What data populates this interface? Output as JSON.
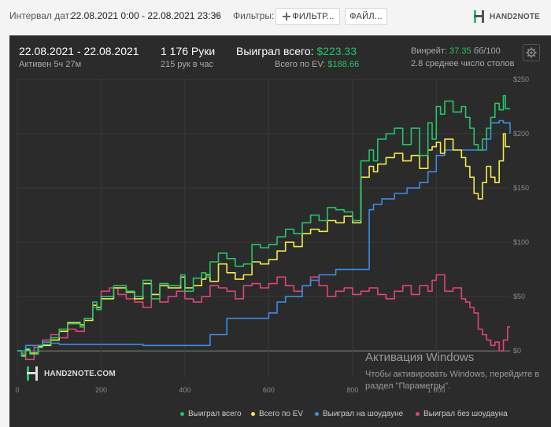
{
  "toolbar": {
    "interval_label": "Интервал дат:",
    "interval_value": "22.08.2021 0:00 - 22.08.2021 23:36",
    "filters_label": "Фильтры:",
    "filter_button": "ФИЛЬТР...",
    "file_button": "ФАЙЛ...",
    "brand": "HAND2NOTE"
  },
  "summary": {
    "date_range": "22.08.2021 - 22.08.2021",
    "active": "Активен 5ч 27м",
    "hands": "1 176 Руки",
    "hands_rate": "215 рук в час",
    "won_label": "Выиграл всего:",
    "won_value": "$223.33",
    "ev_label": "Всего по EV:",
    "ev_value": "$188.66",
    "bb_label": "Винрейт:",
    "bb_value": "37.35",
    "bb_unit": "бб/100",
    "tables": "2.8 среднее число столов"
  },
  "watermark": {
    "title": "Активация Windows",
    "line1": "Чтобы активировать Windows, перейдите в",
    "line2": "раздел \"Параметры\"."
  },
  "chart_logo": "HAND2NOTE.COM",
  "colors": {
    "won": "#27c46b",
    "ev": "#f2e94e",
    "showdown": "#3a8ee6",
    "no_showdown": "#e0447a",
    "background": "#2b2b2b"
  },
  "chart_data": {
    "type": "line",
    "xlabel": "",
    "ylabel": "",
    "xlim": [
      0,
      1176
    ],
    "ylim": [
      -10,
      250
    ],
    "x_ticks": [
      "0",
      "200",
      "400",
      "600",
      "800",
      "1 000"
    ],
    "x_tick_values": [
      0,
      200,
      400,
      600,
      800,
      1000
    ],
    "y_ticks": [
      "$0",
      "$50",
      "$100",
      "$150",
      "$200",
      "$250"
    ],
    "y_tick_values": [
      0,
      50,
      100,
      150,
      200,
      250
    ],
    "grid": true,
    "legend_position": "bottom",
    "series": [
      {
        "name": "Выиграл всего",
        "x": [
          0,
          10,
          20,
          30,
          50,
          60,
          80,
          100,
          120,
          150,
          160,
          180,
          190,
          200,
          230,
          260,
          280,
          300,
          320,
          340,
          360,
          390,
          400,
          420,
          440,
          450,
          460,
          480,
          500,
          520,
          540,
          560,
          580,
          600,
          620,
          640,
          660,
          680,
          700,
          720,
          740,
          760,
          780,
          800,
          820,
          840,
          850,
          860,
          880,
          900,
          920,
          940,
          960,
          980,
          990,
          1000,
          1010,
          1020,
          1040,
          1060,
          1070,
          1080,
          1090,
          1100,
          1110,
          1120,
          1130,
          1140,
          1150,
          1160,
          1165,
          1176
        ],
        "values": [
          0,
          -5,
          2,
          -3,
          5,
          6,
          12,
          20,
          25,
          22,
          30,
          45,
          38,
          50,
          60,
          55,
          50,
          65,
          48,
          62,
          60,
          70,
          55,
          67,
          72,
          68,
          82,
          90,
          85,
          78,
          80,
          98,
          95,
          98,
          105,
          112,
          108,
          118,
          125,
          120,
          132,
          130,
          128,
          120,
          175,
          185,
          175,
          195,
          200,
          205,
          190,
          205,
          180,
          210,
          195,
          225,
          218,
          230,
          220,
          225,
          215,
          205,
          190,
          185,
          195,
          205,
          215,
          228,
          222,
          235,
          223,
          223
        ]
      },
      {
        "name": "Всего по EV",
        "x": [
          0,
          10,
          20,
          30,
          50,
          60,
          80,
          100,
          120,
          150,
          160,
          180,
          190,
          200,
          230,
          260,
          280,
          300,
          320,
          340,
          360,
          390,
          400,
          420,
          440,
          450,
          460,
          480,
          500,
          520,
          540,
          560,
          580,
          600,
          620,
          640,
          660,
          680,
          700,
          720,
          740,
          760,
          780,
          800,
          820,
          840,
          850,
          860,
          880,
          900,
          920,
          940,
          960,
          980,
          990,
          1000,
          1010,
          1020,
          1040,
          1060,
          1070,
          1080,
          1090,
          1100,
          1110,
          1120,
          1130,
          1140,
          1150,
          1160,
          1165,
          1176
        ],
        "values": [
          0,
          -4,
          1,
          -2,
          4,
          5,
          10,
          18,
          26,
          24,
          28,
          42,
          40,
          48,
          58,
          54,
          48,
          62,
          52,
          60,
          58,
          68,
          58,
          60,
          66,
          70,
          64,
          80,
          72,
          66,
          70,
          82,
          80,
          84,
          92,
          100,
          96,
          108,
          112,
          110,
          120,
          118,
          124,
          118,
          160,
          170,
          165,
          172,
          178,
          182,
          175,
          180,
          168,
          185,
          188,
          192,
          182,
          195,
          185,
          178,
          170,
          160,
          145,
          140,
          155,
          170,
          160,
          155,
          175,
          200,
          188,
          188
        ]
      },
      {
        "name": "Выиграл на шоудауне",
        "x": [
          0,
          20,
          40,
          60,
          80,
          100,
          140,
          200,
          300,
          360,
          380,
          400,
          420,
          460,
          500,
          520,
          560,
          580,
          600,
          620,
          640,
          680,
          700,
          720,
          760,
          800,
          820,
          830,
          840,
          850,
          870,
          900,
          930,
          960,
          980,
          1000,
          1020,
          1060,
          1080,
          1100,
          1120,
          1130,
          1140,
          1150,
          1160,
          1176
        ],
        "values": [
          0,
          5,
          3,
          8,
          7,
          6,
          6,
          6,
          5,
          5,
          5,
          5,
          5,
          15,
          30,
          30,
          30,
          30,
          35,
          45,
          50,
          60,
          65,
          70,
          75,
          75,
          75,
          75,
          130,
          135,
          140,
          145,
          150,
          155,
          165,
          180,
          185,
          185,
          185,
          185,
          195,
          210,
          210,
          212,
          210,
          200
        ]
      },
      {
        "name": "Выиграл без шоудауна",
        "x": [
          0,
          10,
          20,
          40,
          60,
          80,
          100,
          120,
          140,
          160,
          180,
          200,
          220,
          240,
          260,
          280,
          300,
          320,
          340,
          360,
          380,
          400,
          420,
          440,
          460,
          480,
          500,
          520,
          540,
          560,
          580,
          600,
          620,
          640,
          660,
          680,
          700,
          720,
          740,
          760,
          780,
          800,
          820,
          840,
          860,
          880,
          900,
          920,
          940,
          960,
          980,
          990,
          1000,
          1020,
          1040,
          1060,
          1070,
          1080,
          1090,
          1100,
          1110,
          1120,
          1130,
          1140,
          1150,
          1160,
          1170,
          1176
        ],
        "values": [
          0,
          -2,
          -8,
          5,
          10,
          15,
          12,
          20,
          18,
          30,
          40,
          55,
          58,
          52,
          48,
          45,
          40,
          52,
          45,
          50,
          55,
          48,
          45,
          50,
          60,
          58,
          55,
          48,
          60,
          62,
          58,
          62,
          68,
          60,
          55,
          60,
          68,
          60,
          50,
          55,
          58,
          52,
          55,
          58,
          52,
          48,
          55,
          60,
          52,
          60,
          55,
          65,
          70,
          55,
          58,
          48,
          45,
          40,
          35,
          20,
          15,
          10,
          5,
          8,
          0,
          10,
          22,
          22
        ]
      }
    ]
  }
}
